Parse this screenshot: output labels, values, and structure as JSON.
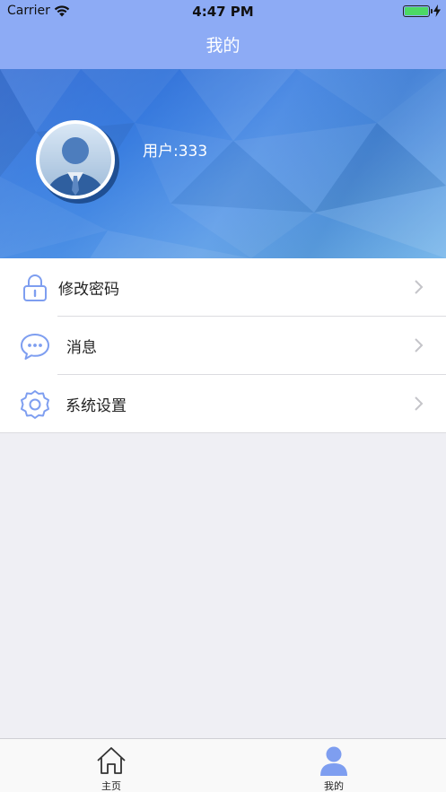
{
  "status_bar": {
    "carrier": "Carrier",
    "time": "4:47 PM",
    "icons": [
      "wifi-icon",
      "battery-icon",
      "charging-bolt-icon"
    ]
  },
  "nav": {
    "title": "我的"
  },
  "profile": {
    "username": "用户:333",
    "avatar": "user-avatar-icon"
  },
  "menu": {
    "items": [
      {
        "label": "修改密码",
        "icon": "lock-icon"
      },
      {
        "label": "消息",
        "icon": "message-icon"
      },
      {
        "label": "系统设置",
        "icon": "settings-gear-icon"
      }
    ]
  },
  "tabbar": {
    "tabs": [
      {
        "label": "主页",
        "icon": "home-icon"
      },
      {
        "label": "我的",
        "icon": "profile-icon"
      }
    ]
  },
  "colors": {
    "nav_bar": "#8dabf5",
    "banner": "#3a7ee0",
    "icon_blue": "#7e9ef0",
    "background": "#efeff4"
  }
}
